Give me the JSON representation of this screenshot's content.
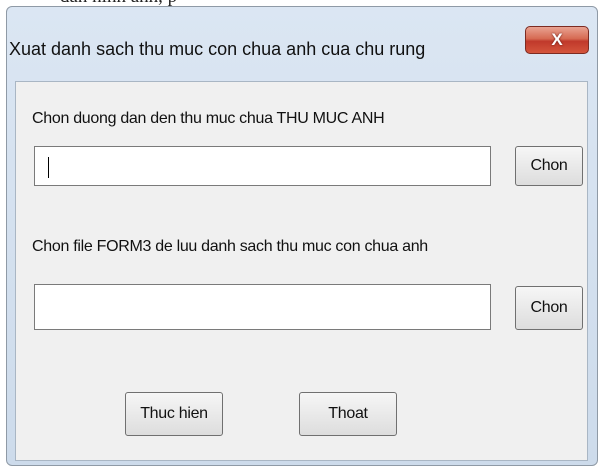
{
  "background_text": "dan hinh anh, p",
  "dialog": {
    "title": "Xuat danh sach thu muc con chua anh cua chu rung",
    "close_label": "X",
    "folder_label": "Chon duong dan den thu muc chua THU MUC ANH",
    "folder_value": "",
    "folder_browse_label": "Chon",
    "file_label": "Chon file FORM3 de luu danh sach thu muc con chua anh",
    "file_value": "",
    "file_browse_label": "Chon",
    "execute_label": "Thuc hien",
    "exit_label": "Thoat"
  }
}
